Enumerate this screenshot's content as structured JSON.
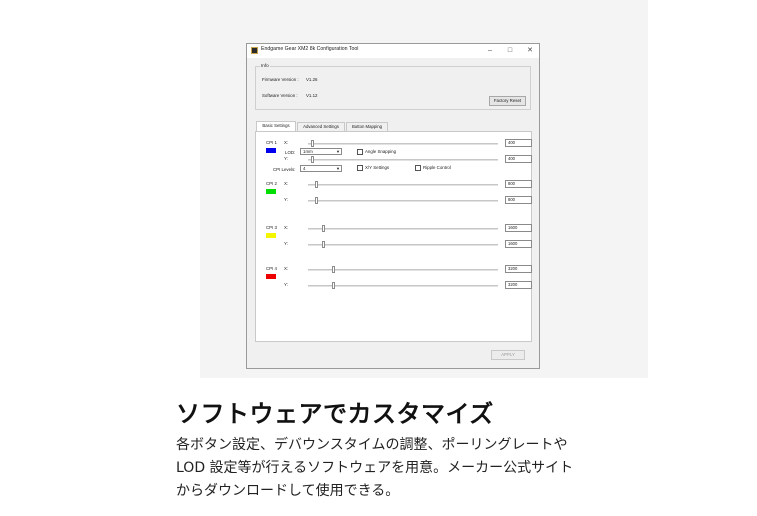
{
  "window": {
    "title": "Endgame Gear XM2 8k Configuration Tool",
    "controls": {
      "minimize": "–",
      "maximize": "□",
      "close": "✕"
    }
  },
  "info": {
    "legend": "Info",
    "firmware_label": "Firmware Version :",
    "firmware_value": "V1.26",
    "software_label": "Software Version :",
    "software_value": "V1.12",
    "factory_reset": "Factory Reset"
  },
  "tabs": [
    "Basic Settings",
    "Advanced Settings",
    "Button Mapping"
  ],
  "basic": {
    "lod_label": "LOD:",
    "lod_value": "1mm",
    "cpi_levels_label": "CPI Levels:",
    "cpi_levels_value": "4",
    "angle_snapping": "Angle Snapping",
    "xy_settings": "X/Y Settings",
    "ripple_control": "Ripple Control",
    "x_label": "X:",
    "y_label": "Y:"
  },
  "cpi": [
    {
      "label": "CPI 1",
      "color": "#0000ee",
      "x": "400",
      "y": "400",
      "x_level": 0.02,
      "y_level": 0.02
    },
    {
      "label": "CPI 2",
      "color": "#00dd00",
      "x": "800",
      "y": "800",
      "x_level": 0.04,
      "y_level": 0.04
    },
    {
      "label": "CPI 3",
      "color": "#f5f500",
      "x": "1600",
      "y": "1600",
      "x_level": 0.08,
      "y_level": 0.08
    },
    {
      "label": "CPI 4",
      "color": "#ee0000",
      "x": "3200",
      "y": "3200",
      "x_level": 0.13,
      "y_level": 0.13
    }
  ],
  "apply": "APPLY",
  "heading": "ソフトウェアでカスタマイズ",
  "description": [
    "各ボタン設定、デバウンスタイムの調整、ポーリングレートや",
    "LOD 設定等が行えるソフトウェアを用意。メーカー公式サイト",
    "からダウンロードして使用できる。"
  ]
}
